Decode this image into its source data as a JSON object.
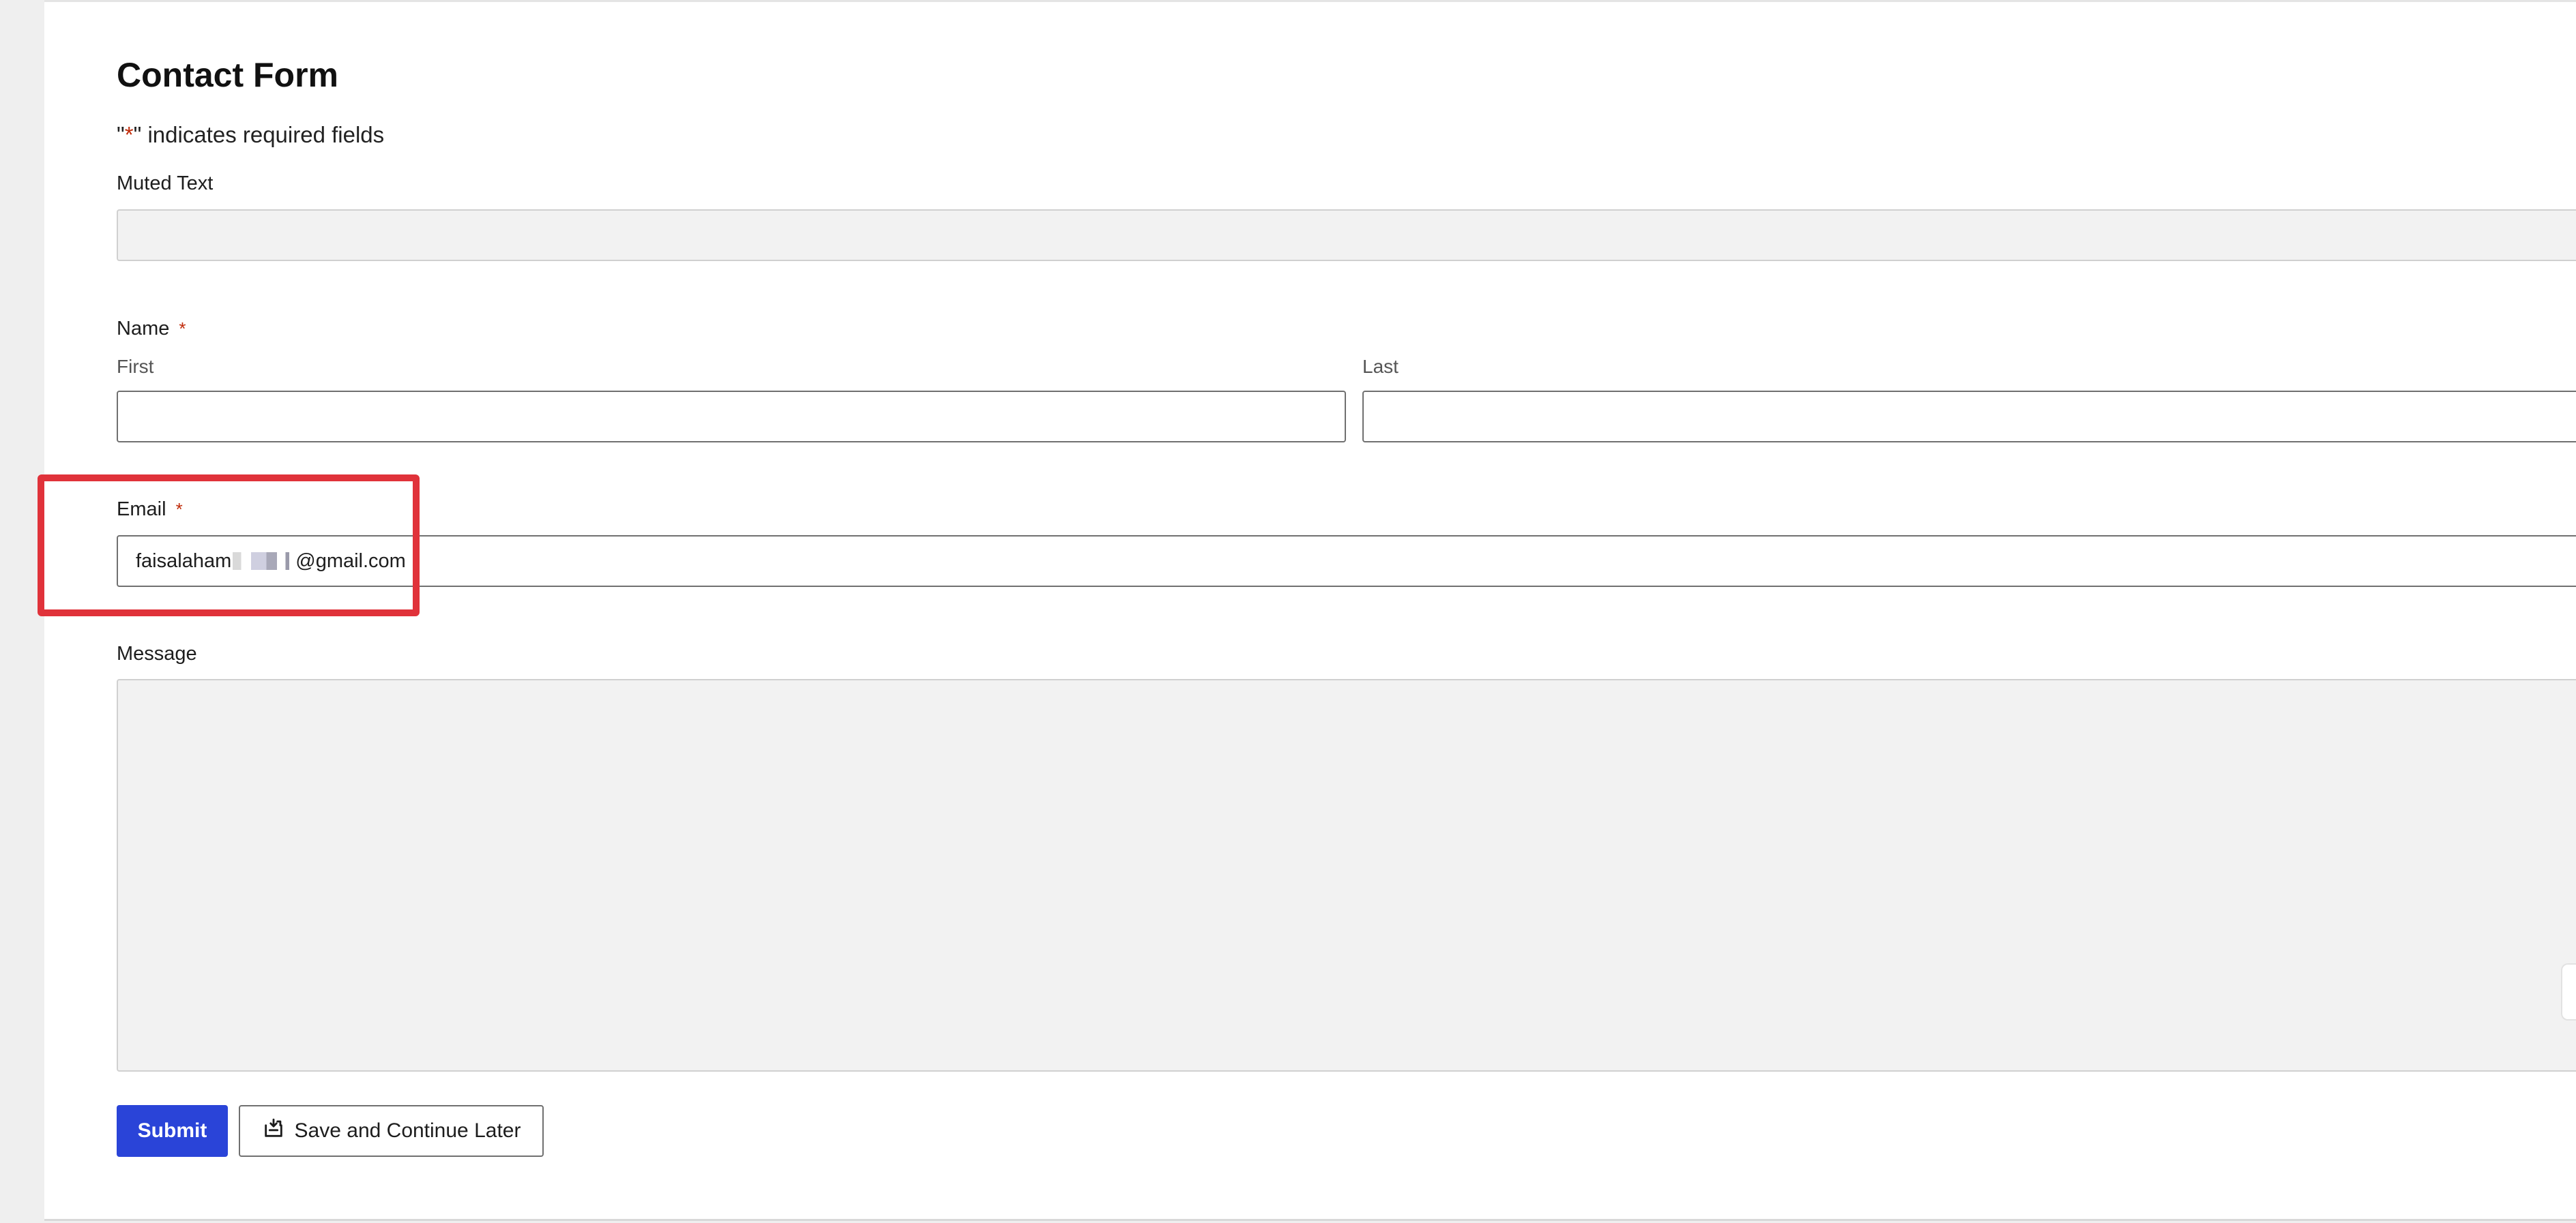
{
  "form": {
    "title": "Contact Form",
    "required_note_prefix": "\"",
    "required_note_star": "*",
    "required_note_suffix": "\" indicates required fields",
    "muted_text": {
      "label": "Muted Text",
      "value": ""
    },
    "name": {
      "label": "Name",
      "required_mark": "*",
      "first_label": "First",
      "last_label": "Last",
      "first_value": "",
      "last_value": ""
    },
    "email": {
      "label": "Email",
      "required_mark": "*",
      "value_prefix": "faisalaham",
      "value_suffix": "@gmail.com"
    },
    "message": {
      "label": "Message",
      "value": ""
    },
    "buttons": {
      "submit": "Submit",
      "save_later": "Save and Continue Later"
    }
  },
  "colors": {
    "accent": "#2a44d8",
    "required": "#c02b0a",
    "highlight": "#e0323a"
  },
  "icons": {
    "save_later": "save-later-icon"
  }
}
